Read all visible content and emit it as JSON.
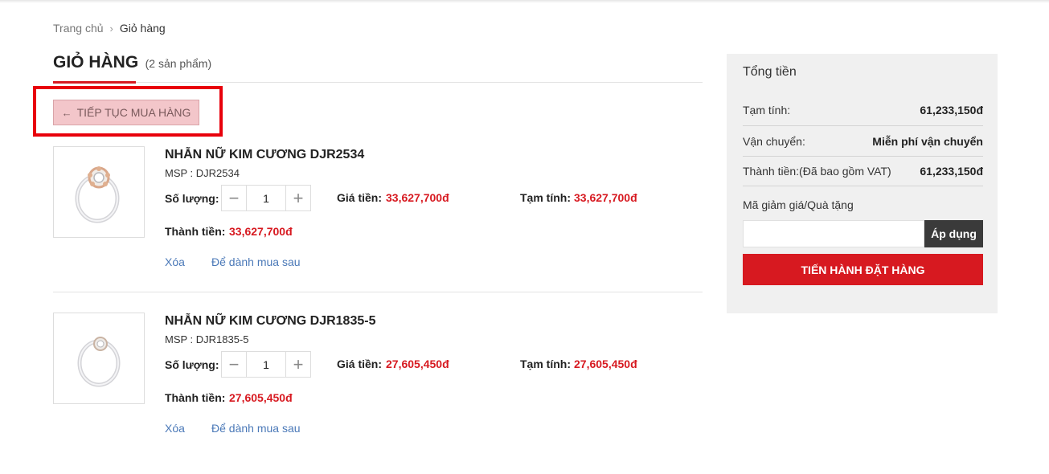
{
  "breadcrumb": {
    "home": "Trang chủ",
    "separator": "›",
    "current": "Giỏ hàng"
  },
  "page": {
    "title": "GIỎ HÀNG",
    "count": "(2 sản phẩm)"
  },
  "continue_button": {
    "icon": "arrow-left-icon",
    "label": "TIẾP TỤC MUA HÀNG"
  },
  "labels": {
    "quantity": "Số lượng:",
    "price": "Giá tiền:",
    "subtotal": "Tạm tính:",
    "total": "Thành tiền:",
    "remove": "Xóa",
    "save_later": "Để dành mua sau"
  },
  "items": [
    {
      "name": "NHẪN NỮ KIM CƯƠNG DJR2534",
      "msp": "MSP : DJR2534",
      "quantity": "1",
      "price": "33,627,700đ",
      "subtotal": "33,627,700đ",
      "total": "33,627,700đ"
    },
    {
      "name": "NHẪN NỮ KIM CƯƠNG DJR1835-5",
      "msp": "MSP : DJR1835-5",
      "quantity": "1",
      "price": "27,605,450đ",
      "subtotal": "27,605,450đ",
      "total": "27,605,450đ"
    }
  ],
  "summary": {
    "title": "Tổng tiền",
    "subtotal_label": "Tạm tính:",
    "subtotal_value": "61,233,150đ",
    "shipping_label": "Vận chuyển:",
    "shipping_value": "Miễn phí vận chuyển",
    "total_label": "Thành tiền:(Đã bao gồm VAT)",
    "total_value": "61,233,150đ",
    "coupon_label": "Mã giảm giá/Quà tặng",
    "coupon_value": "",
    "apply_label": "Áp dụng",
    "checkout_label": "TIẾN HÀNH ĐẶT HÀNG"
  },
  "colors": {
    "accent": "#d71920",
    "link": "#4b79b8",
    "highlight": "#e8000b"
  }
}
